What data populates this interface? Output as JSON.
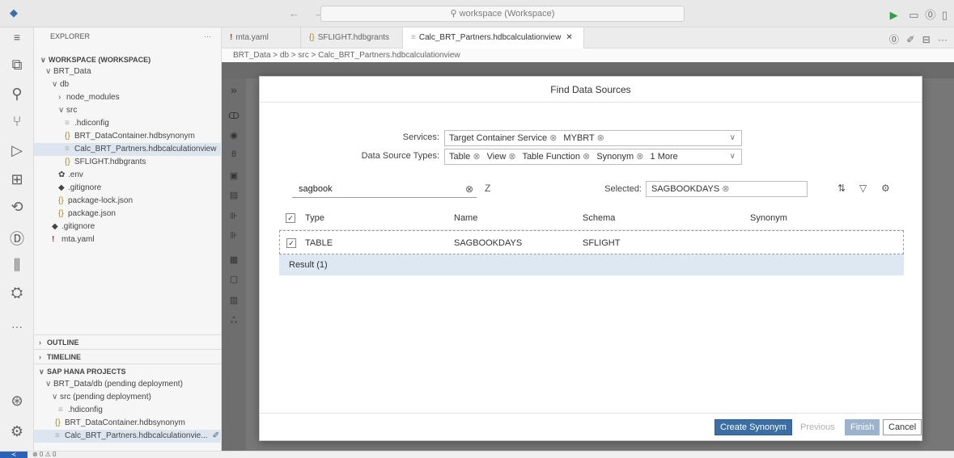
{
  "titlebar": {
    "search_placeholder": "workspace (Workspace)",
    "back": "←",
    "forward": "→"
  },
  "explorer": {
    "header": "EXPLORER",
    "more": "···",
    "workspace": "WORKSPACE (WORKSPACE)",
    "items": [
      {
        "label": "BRT_Data"
      },
      {
        "label": "db"
      },
      {
        "label": "node_modules"
      },
      {
        "label": "src"
      },
      {
        "label": ".hdiconfig"
      },
      {
        "label": "BRT_DataContainer.hdbsynonym"
      },
      {
        "label": "Calc_BRT_Partners.hdbcalculationview"
      },
      {
        "label": "SFLIGHT.hdbgrants"
      },
      {
        "label": ".env"
      },
      {
        "label": ".gitignore"
      },
      {
        "label": "package-lock.json"
      },
      {
        "label": "package.json"
      },
      {
        "label": ".gitignore"
      },
      {
        "label": "mta.yaml"
      }
    ]
  },
  "sections": {
    "outline": "OUTLINE",
    "timeline": "TIMELINE",
    "hana": "SAP HANA PROJECTS",
    "hana_items": [
      {
        "label": "BRT_Data/db  (pending deployment)"
      },
      {
        "label": "src  (pending deployment)"
      },
      {
        "label": ".hdiconfig"
      },
      {
        "label": "BRT_DataContainer.hdbsynonym"
      },
      {
        "label": "Calc_BRT_Partners.hdbcalculationvie..."
      }
    ]
  },
  "tabs": [
    {
      "label": "mta.yaml"
    },
    {
      "label": "SFLIGHT.hdbgrants"
    },
    {
      "label": "Calc_BRT_Partners.hdbcalculationview"
    }
  ],
  "breadcrumb": "BRT_Data > db > src >  Calc_BRT_Partners.hdbcalculationview",
  "dialog": {
    "title": "Find Data Sources",
    "services_label": "Services:",
    "services": [
      "Target Container Service",
      "MYBRT"
    ],
    "types_label": "Data Source Types:",
    "types": [
      "Table",
      "View",
      "Table Function",
      "Synonym",
      "1 More"
    ],
    "search_value": "sagbook",
    "selected_label": "Selected:",
    "selected_value": "SAGBOOKDAYS",
    "columns": [
      "Type",
      "Name",
      "Schema",
      "Synonym"
    ],
    "rows": [
      {
        "type": "TABLE",
        "name": "SAGBOOKDAYS",
        "schema": "SFLIGHT",
        "synonym": ""
      }
    ],
    "result": "Result (1)",
    "buttons": {
      "create": "Create Synonym",
      "previous": "Previous",
      "finish": "Finish",
      "cancel": "Cancel"
    }
  },
  "status": {
    "problems": "⊗ 0 ⚠ 0"
  },
  "colors": {
    "primary": "#3a6ea5",
    "selection": "#dde8f3",
    "run": "#2ea043"
  }
}
